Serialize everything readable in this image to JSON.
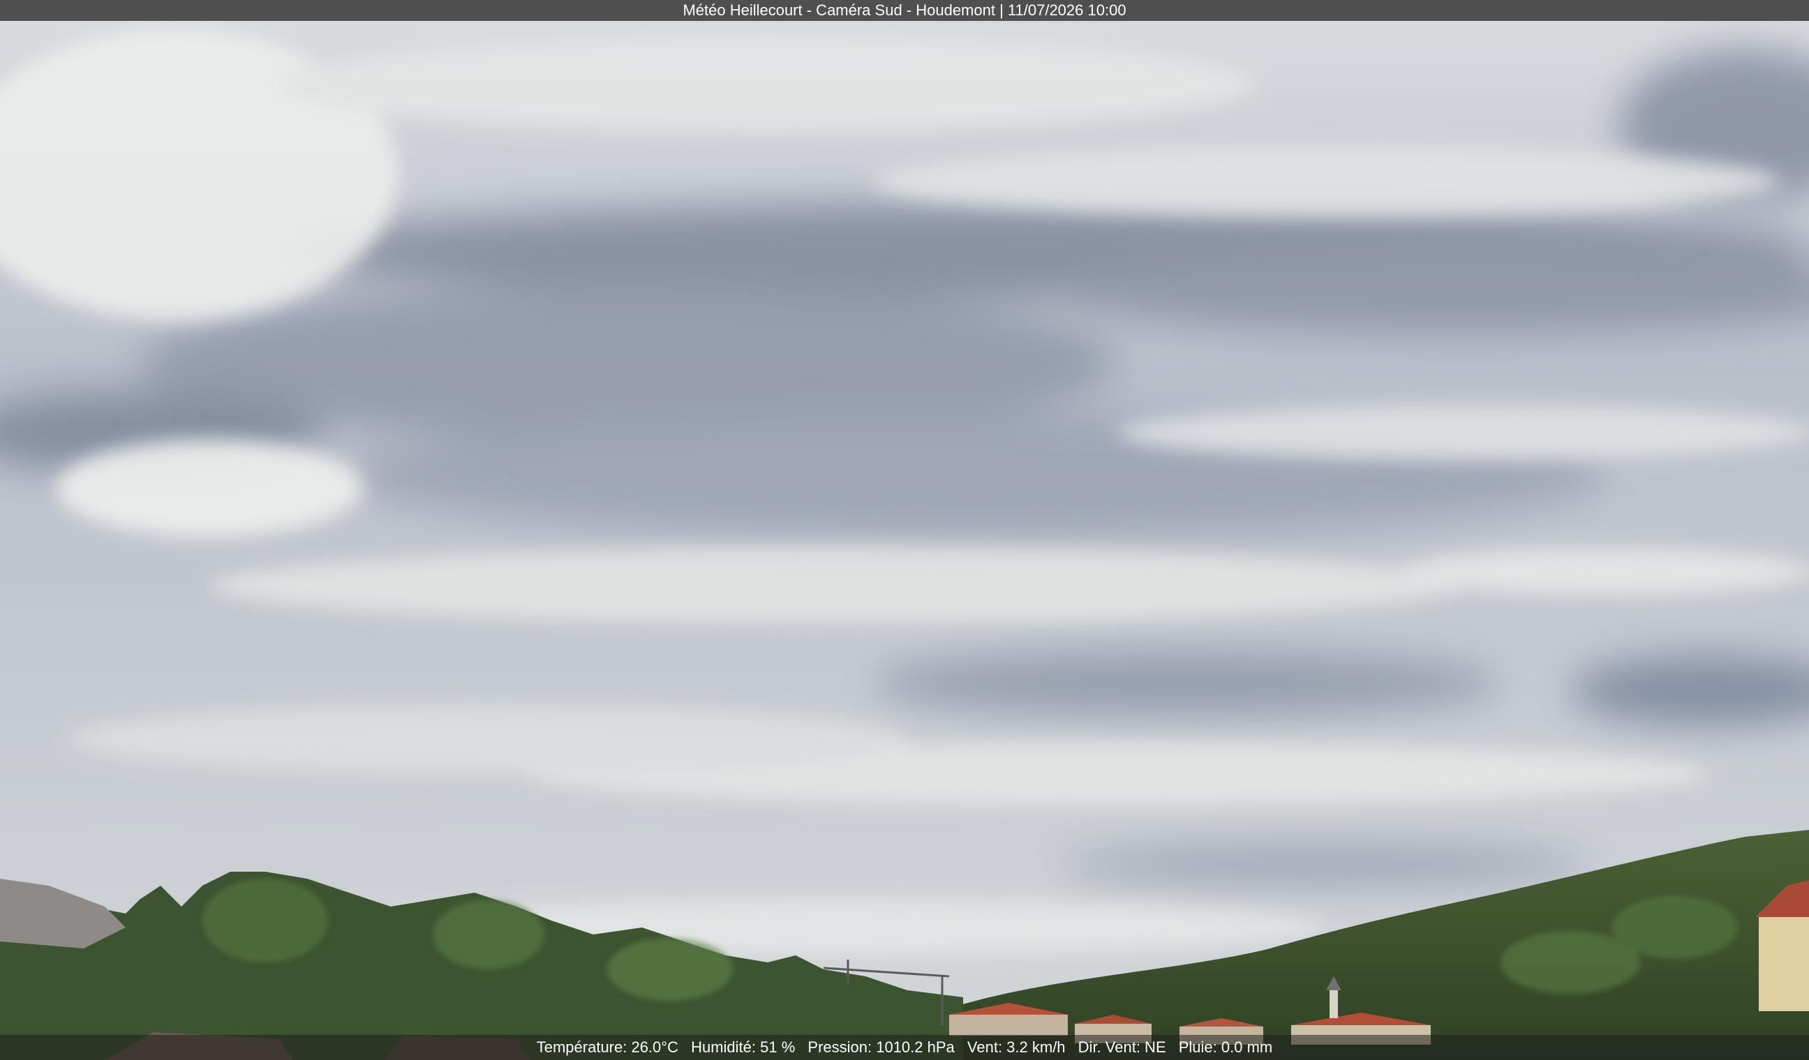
{
  "overlay": {
    "title": "Météo Heillecourt - Caméra Sud - Houdemont | 11/07/2026 10:00"
  },
  "readings": {
    "temperature": "Température: 26.0°C",
    "humidity": "Humidité: 51 %",
    "pressure": "Pression: 1010.2 hPa",
    "wind_speed": "Vent: 3.2 km/h",
    "wind_dir": "Dir. Vent: NE",
    "rain": "Pluie: 0.0 mm"
  },
  "colors": {
    "sky_light": "#e6e8e6",
    "sky_dark": "#8e97a8",
    "forest": "#3f5a2e",
    "roof": "#b5533a",
    "overlay_bg": "#282828",
    "overlay_text": "#ffffff"
  }
}
